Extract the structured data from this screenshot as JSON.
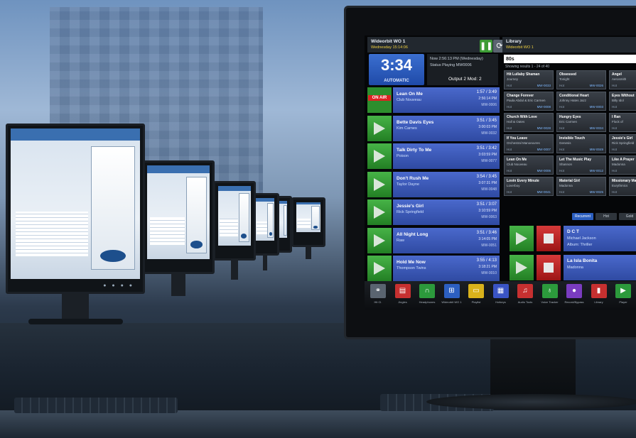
{
  "app": {
    "left_header": {
      "title": "Wideorbit WO 1",
      "subtitle": "Wednesday 15:14:06"
    },
    "controls": {
      "pause_icon": "pause-icon",
      "refresh_icon": "refresh-icon"
    },
    "clock": {
      "time": "3:34",
      "mode": "AUTOMATIC"
    },
    "info": {
      "row1": "Now   2:56:13 PM (Wednesday)",
      "row2": "Status   Playing MW0006",
      "output": "Output 2   Mod: 2"
    },
    "on_air_label": "ON AIR",
    "log_items": [
      {
        "title": "Lean On Me",
        "artist": "Club Nouveau",
        "duration": "1:57 / 3:49",
        "air_time": "2:56:14 PM",
        "code": "MW-0006",
        "on_air": true
      },
      {
        "title": "Bette Davis Eyes",
        "artist": "Kim Carnes",
        "duration": "3:51 / 3:45",
        "air_time": "3:00:03 PM",
        "code": "MW-0032",
        "on_air": false
      },
      {
        "title": "Talk Dirty To Me",
        "artist": "Poison",
        "duration": "3:51 / 3:42",
        "air_time": "3:03:59 PM",
        "code": "MW-0077",
        "on_air": false
      },
      {
        "title": "Don't Rush Me",
        "artist": "Taylor Dayne",
        "duration": "3:54 / 3:45",
        "air_time": "3:07:31 PM",
        "code": "MW-0048",
        "on_air": false
      },
      {
        "title": "Jessie's Girl",
        "artist": "Rick Springfield",
        "duration": "3:51 / 3:07",
        "air_time": "3:10:59 PM",
        "code": "MW-0063",
        "on_air": false
      },
      {
        "title": "All Night Long",
        "artist": "Raw",
        "duration": "3:51 / 3:46",
        "air_time": "3:14:05 PM",
        "code": "MW-0051",
        "on_air": false
      },
      {
        "title": "Hold Me Now",
        "artist": "Thompson Twins",
        "duration": "3:55 / 4:13",
        "air_time": "3:18:21 PM",
        "code": "MW-0010",
        "on_air": false
      }
    ],
    "right_header": {
      "title": "Library",
      "subtitle": "Wideorbit WO 1"
    },
    "search": {
      "value": "80s"
    },
    "showing": "Showing results 1 - 24 of 40",
    "library": [
      [
        {
          "title": "Hit Lullaby Shaman",
          "artist": "Journey",
          "category": "Hot",
          "code": "MW-0033"
        },
        {
          "title": "Obsessed",
          "artist": "Tonight",
          "category": "Hot",
          "code": "MW-0026"
        },
        {
          "title": "Angel",
          "artist": "Aerosmith",
          "category": "Hot",
          "code": "MW-0014"
        }
      ],
      [
        {
          "title": "Change Forever",
          "artist": "Paula Abdul & Eric Carmen",
          "category": "Hot",
          "code": "MW-0008"
        },
        {
          "title": "Conditional Heart",
          "artist": "Johnny Hates Jazz",
          "category": "Hot",
          "code": "MW-0003"
        },
        {
          "title": "Eyes Without",
          "artist": "Billy Idol",
          "category": "Hot",
          "code": "MW-0017"
        }
      ],
      [
        {
          "title": "Church With Love",
          "artist": "Hall & Oates",
          "category": "Hot",
          "code": "MW-0028"
        },
        {
          "title": "Hungry Eyes",
          "artist": "Eric Carmen",
          "category": "Hot",
          "code": "MW-0034"
        },
        {
          "title": "I Ran",
          "artist": "Flock of",
          "category": "Hot",
          "code": "MW-0061"
        }
      ],
      [
        {
          "title": "If You Leave",
          "artist": "Orchestral Manoeuvres",
          "category": "Hot",
          "code": "MW-0007"
        },
        {
          "title": "Invisible Touch",
          "artist": "Genesis",
          "category": "Hot",
          "code": "MW-0049"
        },
        {
          "title": "Jessie's Girl",
          "artist": "Rick Springfield",
          "category": "Hot",
          "code": "MW-0063"
        }
      ],
      [
        {
          "title": "Lean On Me",
          "artist": "Club Nouveau",
          "category": "Hot",
          "code": "MW-0006"
        },
        {
          "title": "Let The Music Play",
          "artist": "Shannon",
          "category": "Hot",
          "code": "MW-0012"
        },
        {
          "title": "Like A Prayer",
          "artist": "Madonna",
          "category": "Hot",
          "code": "MW-0059"
        }
      ],
      [
        {
          "title": "Lovin Every Minute",
          "artist": "Loverboy",
          "category": "Hot",
          "code": "MW-0041"
        },
        {
          "title": "Material Girl",
          "artist": "Madonna",
          "category": "Hot",
          "code": "MW-0025"
        },
        {
          "title": "Missionary Man",
          "artist": "Eurythmics",
          "category": "Hot",
          "code": "MW-0005"
        }
      ]
    ],
    "tabs": [
      "Recurrent",
      "Hot",
      "Gold"
    ],
    "carts": [
      {
        "title": "D C T",
        "line1": "Michael Jackson",
        "line2": "Album: Thriller"
      },
      {
        "title": "La Isla Bonita",
        "line1": "Madonna",
        "line2": ""
      }
    ],
    "taskbar": [
      {
        "label": "Hit Cl.",
        "icon": "link-icon",
        "color": "#5a6470"
      },
      {
        "label": "Jingles",
        "icon": "trash-icon",
        "color": "#c63030"
      },
      {
        "label": "Headphones",
        "icon": "headphones-icon",
        "color": "#2c9a3c"
      },
      {
        "label": "Wideorbit WO 1",
        "icon": "network-icon",
        "color": "#2c5fc0"
      },
      {
        "label": "Playlist",
        "icon": "folder-icon",
        "color": "#d9b21b"
      },
      {
        "label": "Hotkeys",
        "icon": "grid-icon",
        "color": "#3a54c4"
      },
      {
        "label": "Audio Tools",
        "icon": "music-icon",
        "color": "#c63030"
      },
      {
        "label": "Voice Tracker",
        "icon": "microphone-icon",
        "color": "#2c9a3c"
      },
      {
        "label": "Record/Bypass",
        "icon": "record-icon",
        "color": "#7a3cc0"
      },
      {
        "label": "Library",
        "icon": "book-icon",
        "color": "#c63030"
      },
      {
        "label": "Player",
        "icon": "play-icon",
        "color": "#2c9a3c"
      }
    ]
  }
}
